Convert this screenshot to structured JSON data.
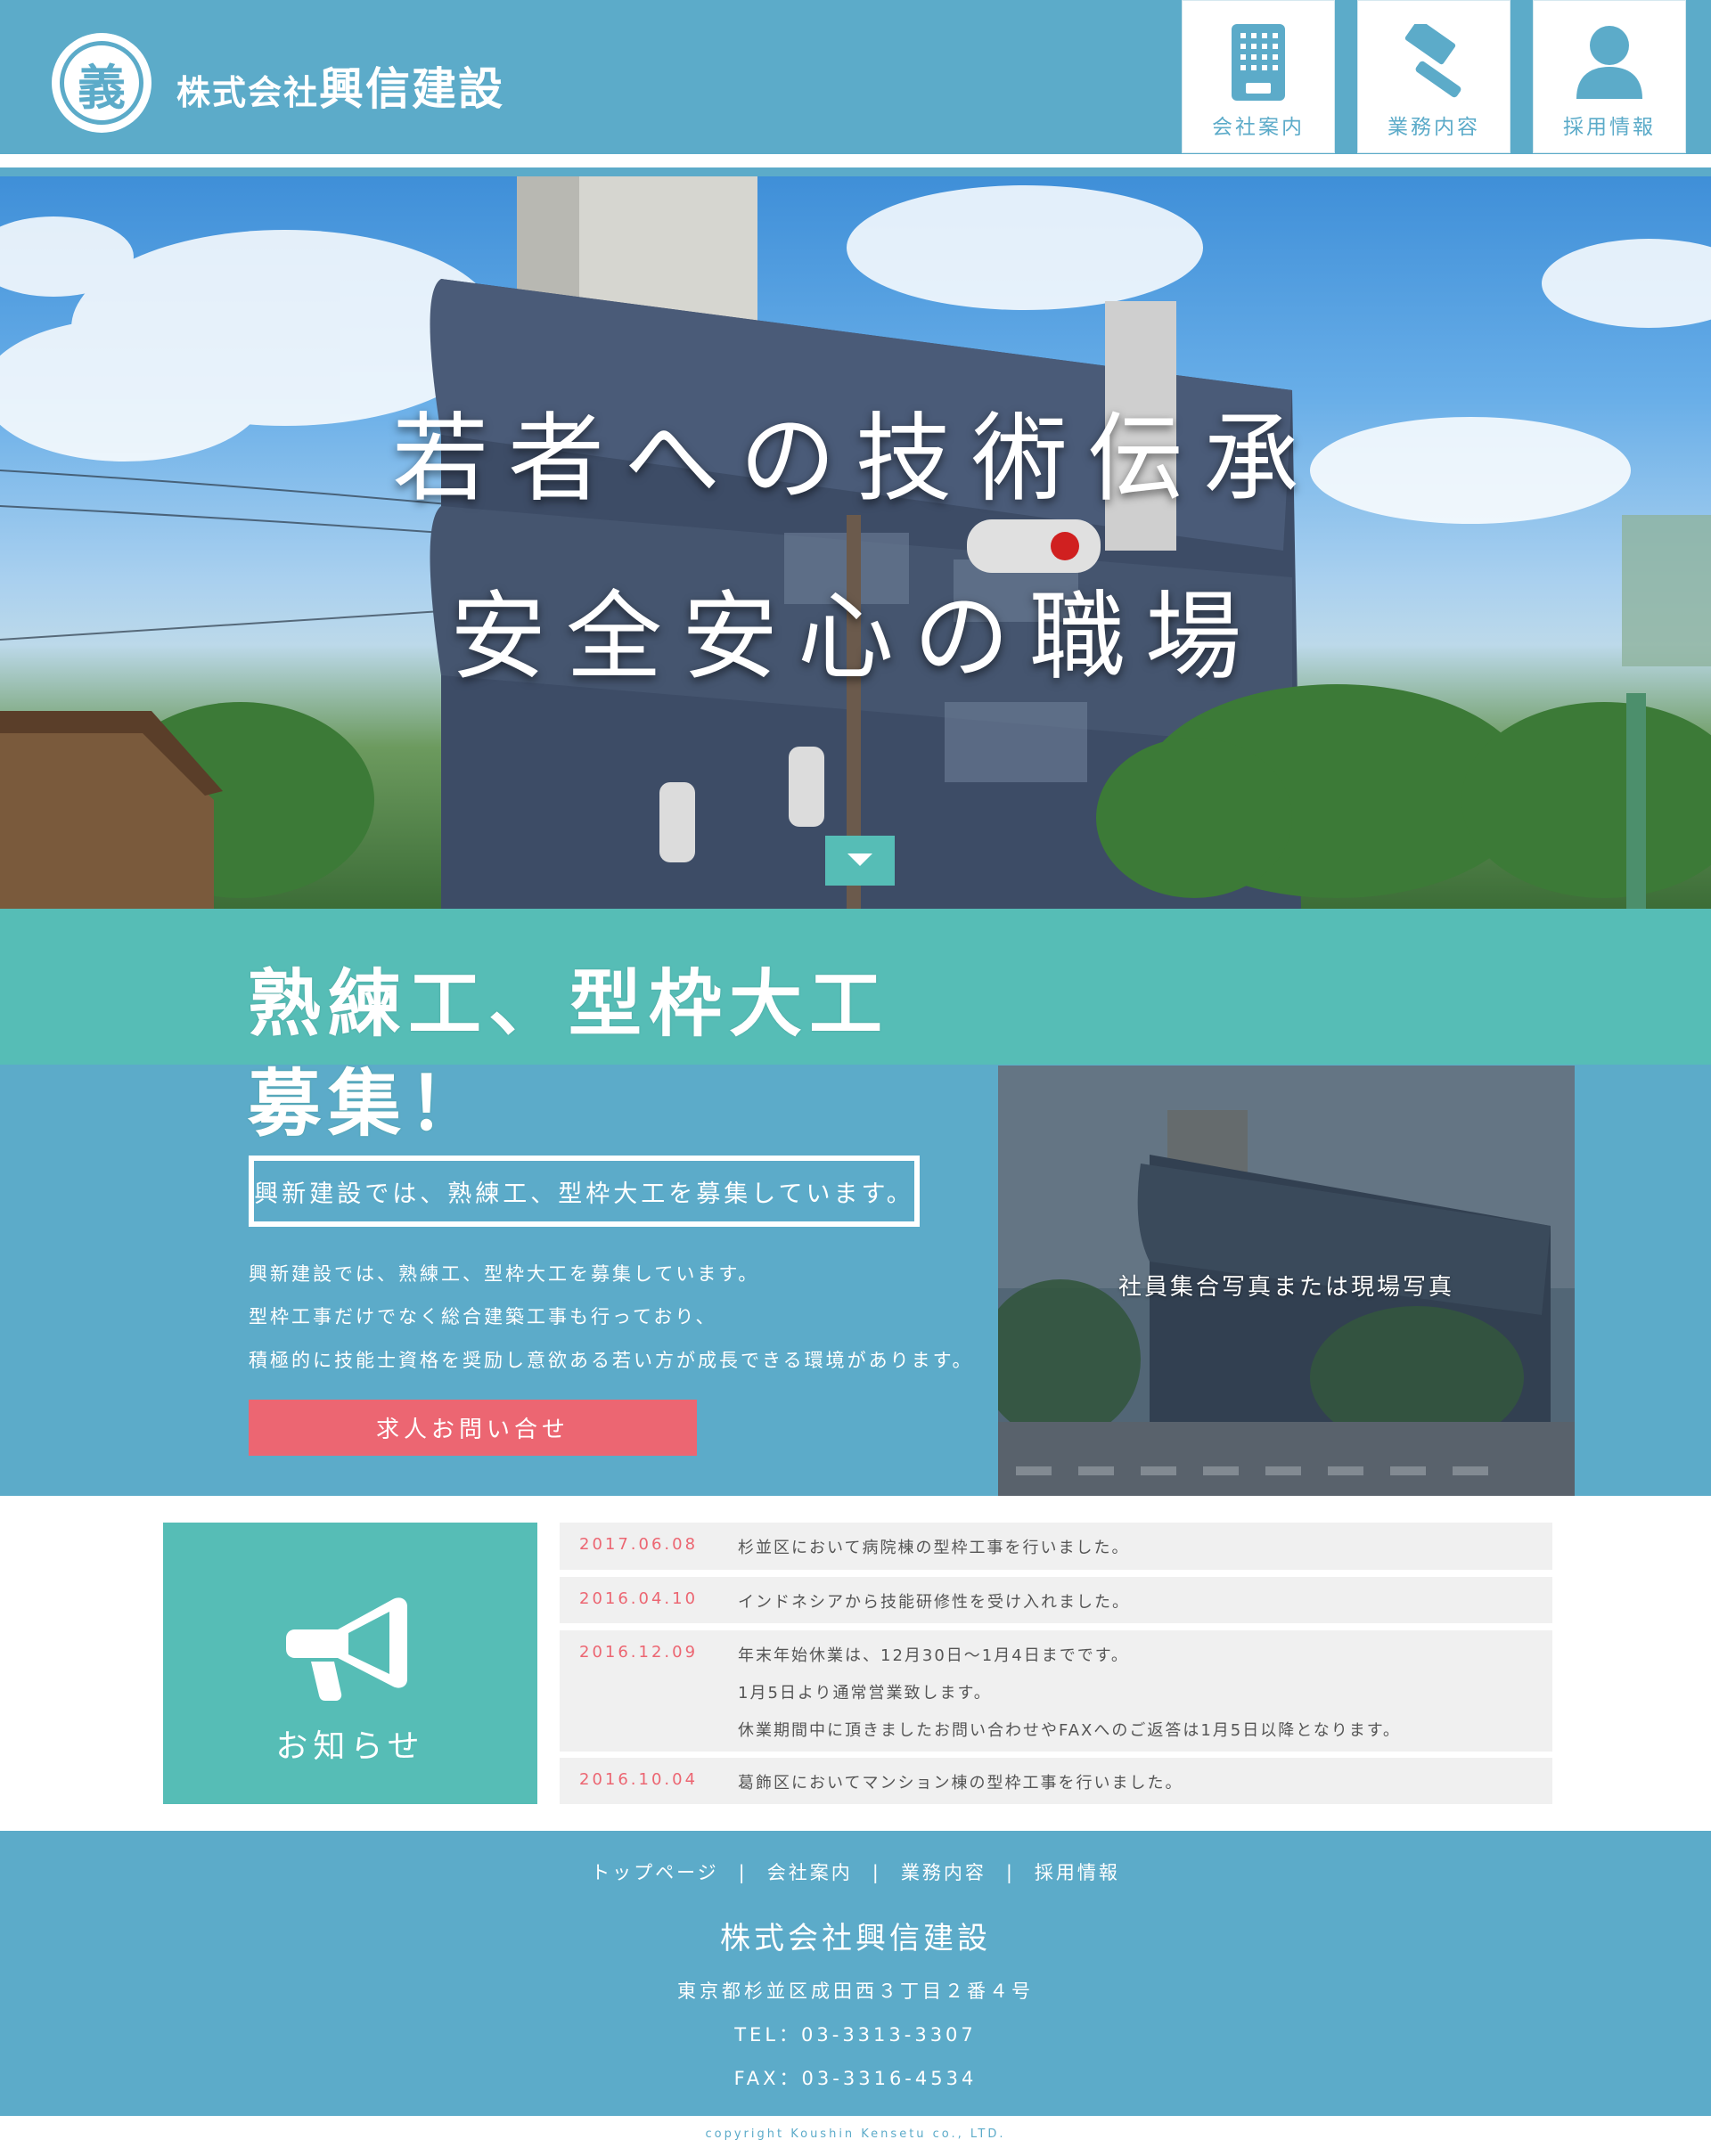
{
  "colors": {
    "primary_blue": "#5cabc9",
    "teal": "#56bdb6",
    "accent_red": "#ec6672",
    "news_bg": "#f0f0f0"
  },
  "header": {
    "logo_char": "義",
    "company_prefix": "株式会社",
    "company_name": "興信建設",
    "nav": [
      {
        "label": "会社案内",
        "icon": "building-icon"
      },
      {
        "label": "業務内容",
        "icon": "hammer-icon"
      },
      {
        "label": "採用情報",
        "icon": "person-icon"
      }
    ]
  },
  "hero": {
    "line1": "若者への技術伝承",
    "line2": "安全安心の職場",
    "scroll_icon": "caret-down-icon"
  },
  "recruit": {
    "title_line1": "熟練工、型枠大工",
    "title_line2": "募集！",
    "box_text": "興新建設では、熟練工、型枠大工を募集しています。",
    "paragraphs": [
      "興新建設では、熟練工、型枠大工を募集しています。",
      "型枠工事だけでなく総合建築工事も行っており、",
      "積極的に技能士資格を奨励し意欲ある若い方が成長できる環境があります。"
    ],
    "cta_label": "求人お問い合せ",
    "photo_caption": "社員集合写真または現場写真"
  },
  "news": {
    "label": "お知らせ",
    "icon": "megaphone-icon",
    "items": [
      {
        "date": "2017.06.08",
        "lines": [
          "杉並区において病院棟の型枠工事を行いました。"
        ]
      },
      {
        "date": "2016.04.10",
        "lines": [
          "インドネシアから技能研修性を受け入れました。"
        ]
      },
      {
        "date": "2016.12.09",
        "lines": [
          "年末年始休業は、12月30日〜1月4日までです。",
          "1月5日より通常営業致します。",
          "休業期間中に頂きましたお問い合わせやFAXへのご返答は1月5日以降となります。"
        ]
      },
      {
        "date": "2016.10.04",
        "lines": [
          "葛飾区においてマンション棟の型枠工事を行いました。"
        ]
      }
    ]
  },
  "footer": {
    "nav": [
      "トップページ",
      "会社案内",
      "業務内容",
      "採用情報"
    ],
    "separator": "|",
    "company": "株式会社興信建設",
    "address": "東京都杉並区成田西３丁目２番４号",
    "tel": "TEL：03-3313-3307",
    "fax": "FAX：03-3316-4534",
    "copyright": "copyright Koushin Kensetu co., LTD."
  }
}
